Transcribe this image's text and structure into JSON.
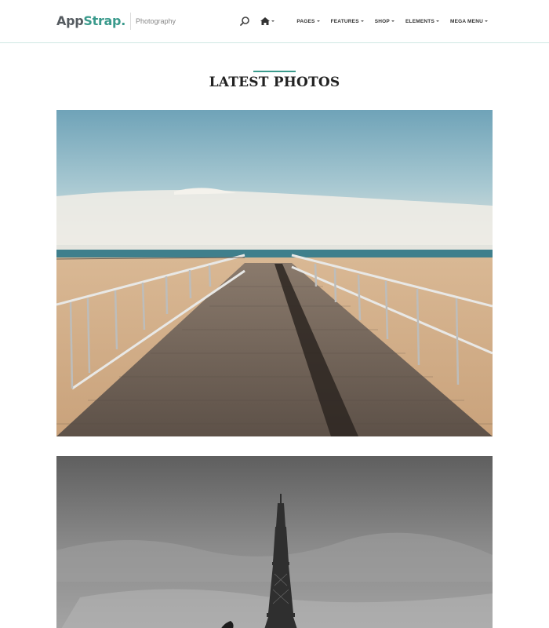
{
  "brand": {
    "name_part1": "App",
    "name_part2": "Strap",
    "name_dot": ".",
    "tagline": "Photography"
  },
  "nav": {
    "search_icon": "search-icon",
    "home_icon": "home-icon",
    "items": [
      {
        "label": "PAGES"
      },
      {
        "label": "FEATURES"
      },
      {
        "label": "SHOP"
      },
      {
        "label": "ELEMENTS"
      },
      {
        "label": "MEGA MENU"
      }
    ]
  },
  "section": {
    "title": "LATEST PHOTOS"
  },
  "photos": [
    {
      "subject": "boardwalk-beach-photo"
    },
    {
      "subject": "eiffel-tower-photo"
    }
  ],
  "colors": {
    "accent": "#3a9a8c",
    "heading": "#222222",
    "nav_text": "#333333",
    "header_border": "#cfe7e3"
  }
}
